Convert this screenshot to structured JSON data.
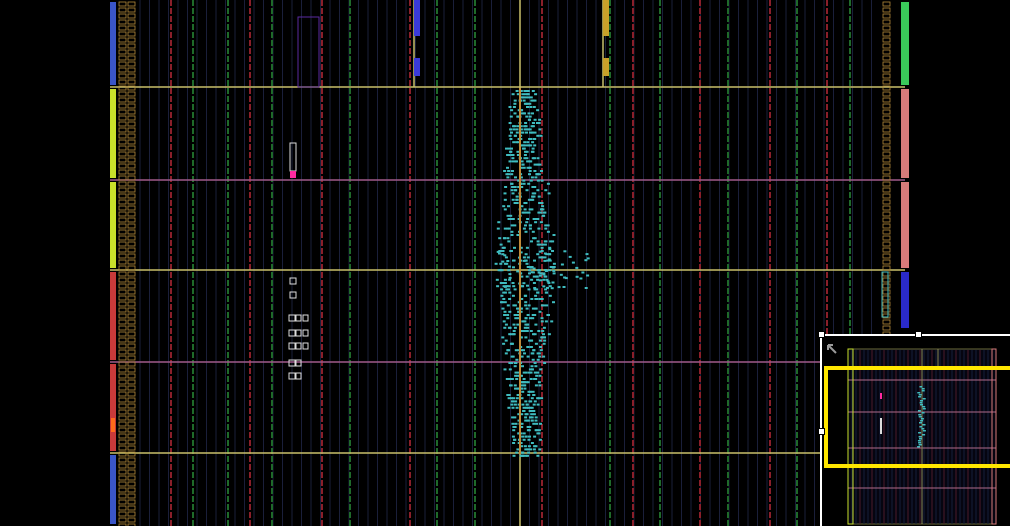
{
  "app": {
    "view": "device-floorplan",
    "zoom_preview": "world-view-minimap"
  },
  "colors": {
    "background": "#000000",
    "clock_region_border_a": "#c9c06a",
    "clock_region_border_b": "#a05a8a",
    "column_red": "#8a1f2a",
    "column_green": "#1f6a2a",
    "column_blue": "#1f2a8a",
    "io_bank_orange": "#b58a3a",
    "placed_cells": "#3fbcc0",
    "pblock_magenta": "#ff2aa0",
    "left_edge_blue": "#3a55c8",
    "left_edge_yellow": "#c8e02a",
    "left_edge_red": "#c83a3a",
    "right_edge_green": "#3ac85a",
    "right_edge_salmon": "#d87a7a",
    "right_edge_blue": "#2a2ac8",
    "minimap_viewport": "#ffe600",
    "minimap_border": "#ffffff"
  },
  "icons": {
    "minimap_move": "diagonal-arrow-icon"
  }
}
